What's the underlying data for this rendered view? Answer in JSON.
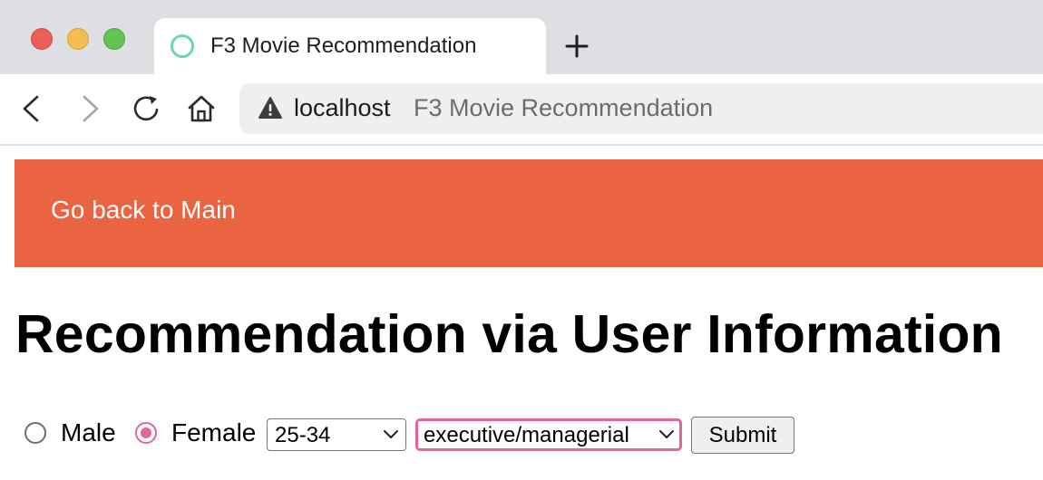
{
  "browser": {
    "tab": {
      "title": "F3 Movie Recommendation",
      "favicon": "circle-favicon-icon"
    },
    "new_tab_icon": "plus-icon",
    "address_bar": {
      "security_icon": "warning-icon",
      "host": "localhost",
      "page_title": "F3 Movie Recommendation"
    },
    "controls": [
      "back-icon",
      "forward-icon",
      "reload-icon",
      "home-icon"
    ]
  },
  "banner": {
    "link_label": "Go back to Main",
    "color": "#eb6442"
  },
  "main": {
    "title": "Recommendation via User Information",
    "form": {
      "gender": {
        "options": [
          {
            "label": "Male",
            "checked": false
          },
          {
            "label": "Female",
            "checked": true
          }
        ]
      },
      "age_select": {
        "selected": "25-34"
      },
      "occupation_select": {
        "selected": "executive/managerial",
        "focused": true
      },
      "submit_label": "Submit"
    }
  },
  "colors": {
    "accent_pink": "#e4649c",
    "tab_strip": "#dedfe3",
    "favicon_ring": "#6fd3b7"
  }
}
